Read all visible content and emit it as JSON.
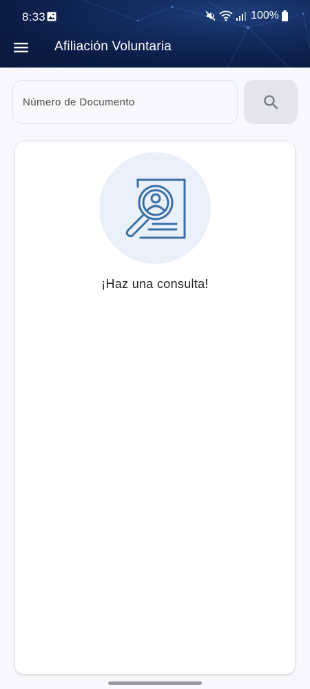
{
  "status_bar": {
    "time": "8:33",
    "battery": "100%",
    "icons": [
      "image-icon",
      "mute-icon",
      "wifi-icon",
      "signal-icon",
      "battery-icon"
    ]
  },
  "app_bar": {
    "title": "Afiliación Voluntaria",
    "menu_icon": "menu-icon"
  },
  "search": {
    "placeholder": "Número de Documento",
    "value": "",
    "button_icon": "search-icon"
  },
  "empty_state": {
    "illustration_icon": "document-search-icon",
    "message": "¡Haz una consulta!"
  },
  "colors": {
    "header_bg": "#0b1c45",
    "accent": "#3a6ea5",
    "illustration_bg": "#e9f0fa",
    "button_bg": "#e4e5e9"
  }
}
